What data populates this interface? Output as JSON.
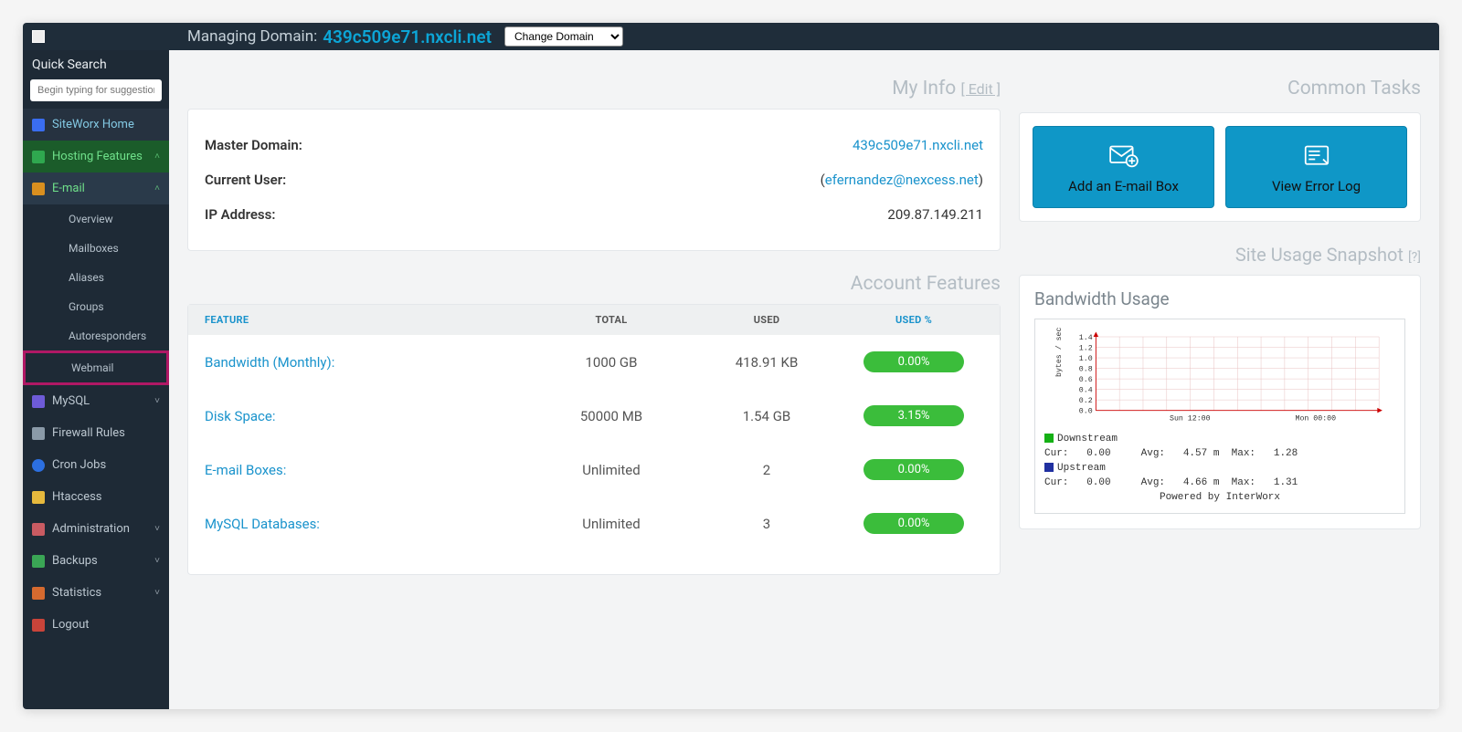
{
  "topbar": {
    "managing_label": "Managing Domain:",
    "domain": "439c509e71.nxcli.net",
    "select_placeholder": "Change Domain"
  },
  "sidebar": {
    "quick_search_label": "Quick Search",
    "quick_search_placeholder": "Begin typing for suggestions",
    "items": {
      "home": "SiteWorx Home",
      "hosting": "Hosting Features",
      "email": "E-mail",
      "email_children": [
        "Overview",
        "Mailboxes",
        "Aliases",
        "Groups",
        "Autoresponders",
        "Webmail"
      ],
      "mysql": "MySQL",
      "firewall": "Firewall Rules",
      "cron": "Cron Jobs",
      "htaccess": "Htaccess",
      "admin": "Administration",
      "backups": "Backups",
      "stats": "Statistics",
      "logout": "Logout"
    }
  },
  "myinfo": {
    "title": "My Info",
    "edit": "[ Edit ]",
    "master_label": "Master Domain:",
    "master_value": "439c509e71.nxcli.net",
    "user_label": "Current User:",
    "user_value": "efernandez@nexcess.net",
    "ip_label": "IP Address:",
    "ip_value": "209.87.149.211"
  },
  "features": {
    "title": "Account Features",
    "head": {
      "feature": "FEATURE",
      "total": "TOTAL",
      "used": "USED",
      "pct": "USED %"
    },
    "rows": [
      {
        "name": "Bandwidth (Monthly):",
        "total": "1000 GB",
        "used": "418.91 KB",
        "pct": "0.00%"
      },
      {
        "name": "Disk Space:",
        "total": "50000 MB",
        "used": "1.54 GB",
        "pct": "3.15%"
      },
      {
        "name": "E-mail Boxes:",
        "total": "Unlimited",
        "used": "2",
        "pct": "0.00%"
      },
      {
        "name": "MySQL Databases:",
        "total": "Unlimited",
        "used": "3",
        "pct": "0.00%"
      }
    ]
  },
  "tasks": {
    "title": "Common Tasks",
    "add_email": "Add an E-mail Box",
    "error_log": "View Error Log"
  },
  "snapshot": {
    "title": "Site Usage Snapshot",
    "q": "[?]",
    "bw_title": "Bandwidth Usage"
  },
  "chart_data": {
    "type": "line",
    "title": "Bandwidth Usage",
    "ylabel": "bytes / sec",
    "ylim": [
      0,
      1.4
    ],
    "yticks": [
      0.0,
      0.2,
      0.4,
      0.6,
      0.8,
      1.0,
      1.2,
      1.4
    ],
    "x_ticks": [
      "Sun 12:00",
      "Mon 00:00"
    ],
    "series": [
      {
        "name": "Downstream",
        "color": "#14b014",
        "stats": {
          "cur": 0.0,
          "avg": "4.57 m",
          "max": 1.28
        }
      },
      {
        "name": "Upstream",
        "color": "#2030a0",
        "stats": {
          "cur": 0.0,
          "avg": "4.66 m",
          "max": 1.31
        }
      }
    ],
    "legend_lines": {
      "down_name": "Downstream",
      "down_stats": "Cur:   0.00     Avg:   4.57 m  Max:   1.28",
      "up_name": "Upstream",
      "up_stats": "Cur:   0.00     Avg:   4.66 m  Max:   1.31",
      "powered": "Powered by InterWorx"
    }
  }
}
